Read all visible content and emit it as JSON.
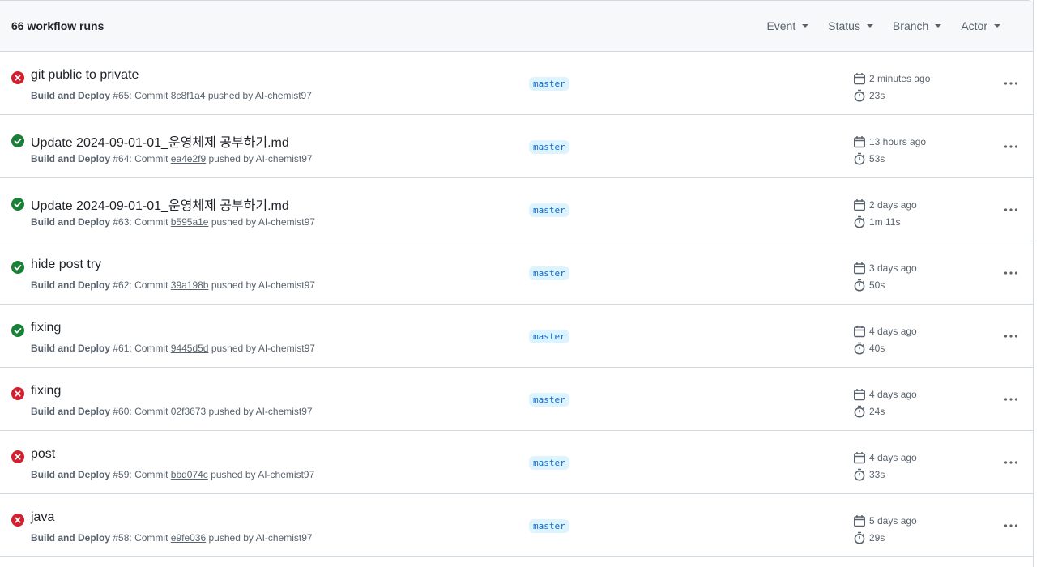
{
  "header": {
    "run_count": "66 workflow runs",
    "filters": [
      {
        "label": "Event"
      },
      {
        "label": "Status"
      },
      {
        "label": "Branch"
      },
      {
        "label": "Actor"
      }
    ]
  },
  "colors": {
    "success": "#1a7f37",
    "failure": "#cf222e",
    "branch_text": "#0969da",
    "branch_bg": "#ddf4ff"
  },
  "runs": [
    {
      "status": "failure",
      "title": "git public to private",
      "workflow": "Build and Deploy",
      "number": "#65",
      "sha": "8c8f1a4",
      "pusher": "AI-chemist97",
      "branch": "master",
      "time": "2 minutes ago",
      "duration": "23s"
    },
    {
      "status": "success",
      "title": "Update 2024-09-01-01_운영체제 공부하기.md",
      "workflow": "Build and Deploy",
      "number": "#64",
      "sha": "ea4e2f9",
      "pusher": "AI-chemist97",
      "branch": "master",
      "time": "13 hours ago",
      "duration": "53s"
    },
    {
      "status": "success",
      "title": "Update 2024-09-01-01_운영체제 공부하기.md",
      "workflow": "Build and Deploy",
      "number": "#63",
      "sha": "b595a1e",
      "pusher": "AI-chemist97",
      "branch": "master",
      "time": "2 days ago",
      "duration": "1m 11s"
    },
    {
      "status": "success",
      "title": "hide post try",
      "workflow": "Build and Deploy",
      "number": "#62",
      "sha": "39a198b",
      "pusher": "AI-chemist97",
      "branch": "master",
      "time": "3 days ago",
      "duration": "50s"
    },
    {
      "status": "success",
      "title": "fixing",
      "workflow": "Build and Deploy",
      "number": "#61",
      "sha": "9445d5d",
      "pusher": "AI-chemist97",
      "branch": "master",
      "time": "4 days ago",
      "duration": "40s"
    },
    {
      "status": "failure",
      "title": "fixing",
      "workflow": "Build and Deploy",
      "number": "#60",
      "sha": "02f3673",
      "pusher": "AI-chemist97",
      "branch": "master",
      "time": "4 days ago",
      "duration": "24s"
    },
    {
      "status": "failure",
      "title": "post",
      "workflow": "Build and Deploy",
      "number": "#59",
      "sha": "bbd074c",
      "pusher": "AI-chemist97",
      "branch": "master",
      "time": "4 days ago",
      "duration": "33s"
    },
    {
      "status": "failure",
      "title": "java",
      "workflow": "Build and Deploy",
      "number": "#58",
      "sha": "e9fe036",
      "pusher": "AI-chemist97",
      "branch": "master",
      "time": "5 days ago",
      "duration": "29s"
    }
  ],
  "labels": {
    "commit_word": "Commit",
    "pushed_by": "pushed by"
  }
}
